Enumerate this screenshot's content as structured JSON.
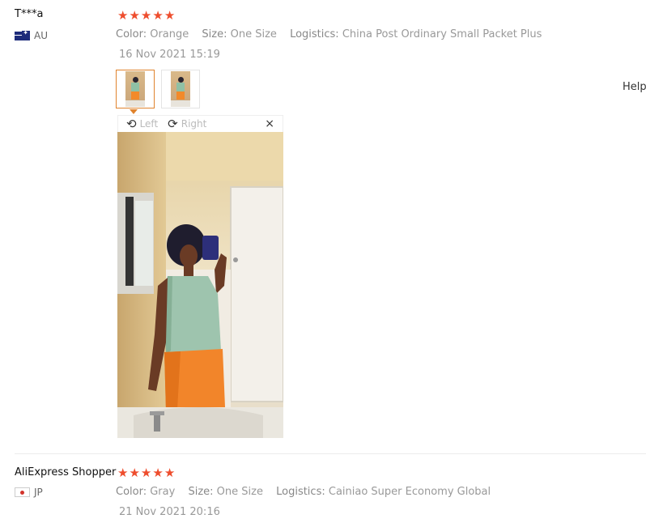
{
  "help_label": "Help",
  "reviews": [
    {
      "user": "T***a",
      "country": "AU",
      "rating": 5,
      "attributes": [
        {
          "key": "Color:",
          "value": "Orange"
        },
        {
          "key": "Size:",
          "value": "One Size"
        },
        {
          "key": "Logistics:",
          "value": "China Post Ordinary Small Packet Plus"
        }
      ],
      "date": "16 Nov 2021 15:19"
    },
    {
      "user": "AliExpress Shopper",
      "country": "JP",
      "rating": 5,
      "attributes": [
        {
          "key": "Color:",
          "value": "Gray"
        },
        {
          "key": "Size:",
          "value": "One Size"
        },
        {
          "key": "Logistics:",
          "value": "Cainiao Super Economy Global"
        }
      ],
      "date": "21 Nov 2021 20:16"
    }
  ],
  "viewer": {
    "rotate_left_label": "Left",
    "rotate_right_label": "Right",
    "close_symbol": "×"
  },
  "icons": {
    "star": "star-icon",
    "rotate_left": "rotate-left-icon",
    "rotate_right": "rotate-right-icon",
    "close": "close-icon"
  },
  "colors": {
    "star": "#ee4d2d",
    "active_thumb_border": "#e0832d"
  }
}
